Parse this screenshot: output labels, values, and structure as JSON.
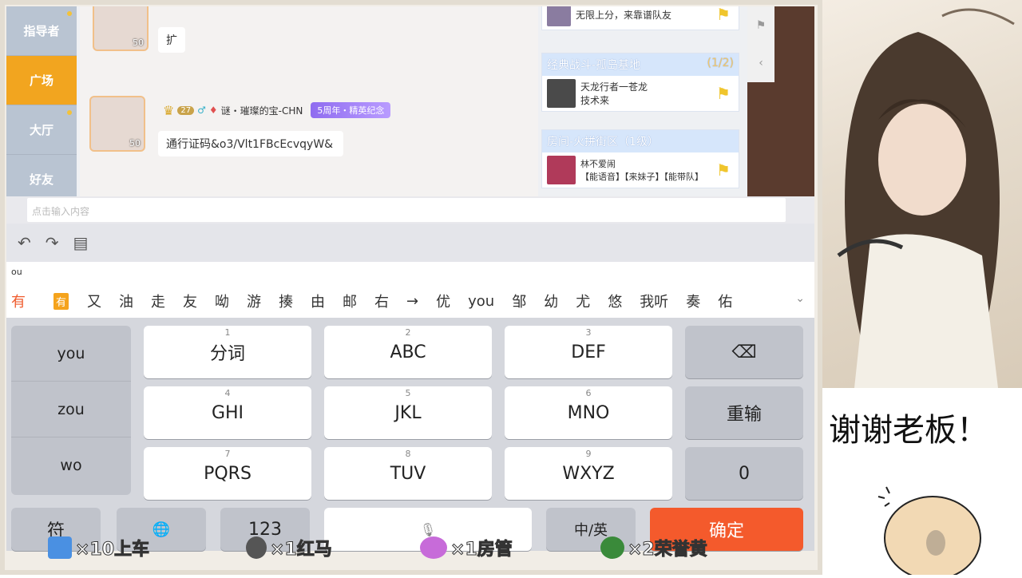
{
  "nav": {
    "tabs": [
      {
        "label": "指导者",
        "dot": true
      },
      {
        "label": "广场",
        "active": true
      },
      {
        "label": "大厅",
        "dot": true
      },
      {
        "label": "好友"
      }
    ]
  },
  "chat": {
    "msg1": {
      "text": "扩",
      "level": "50"
    },
    "msg2": {
      "level": "50",
      "user_level": "27",
      "name": "谜・璀璨的宝-CHN",
      "medal": "5周年・精英纪念",
      "text": "通行证码&o3/Vlt1FBcEcvqyW&"
    }
  },
  "rooms": [
    {
      "title": "",
      "count": "",
      "player": "无限上分，来靠谱队友",
      "sub": ""
    },
    {
      "title": "经典战斗-孤岛基地",
      "count": "(1/2)",
      "player": "天龙行者一苍龙",
      "sub": "技术来"
    },
    {
      "title": "房间-火拼街区（1级）",
      "count": "",
      "player": "林不爱闹",
      "sub": "【能语音】【来妹子】【能带队】"
    }
  ],
  "input": {
    "placeholder": "点击输入内容"
  },
  "candidates": {
    "pinyin": "ou",
    "first": "有",
    "tag": "有",
    "items": [
      "又",
      "油",
      "走",
      "友",
      "呦",
      "游",
      "揍",
      "由",
      "邮",
      "右",
      "→",
      "优",
      "you",
      "邹",
      "幼",
      "尤",
      "悠",
      "我听",
      "奏",
      "佑"
    ]
  },
  "keyboard": {
    "left": [
      "you",
      "zou",
      "wo"
    ],
    "keys": [
      {
        "num": "1",
        "label": "分词"
      },
      {
        "num": "2",
        "label": "ABC"
      },
      {
        "num": "3",
        "label": "DEF"
      },
      {
        "num": "4",
        "label": "GHI"
      },
      {
        "num": "5",
        "label": "JKL"
      },
      {
        "num": "6",
        "label": "MNO"
      },
      {
        "num": "7",
        "label": "PQRS"
      },
      {
        "num": "8",
        "label": "TUV"
      },
      {
        "num": "9",
        "label": "WXYZ"
      }
    ],
    "backspace": "⌫",
    "reenter": "重输",
    "zero": "0",
    "symbol": "符",
    "globe": "🌐",
    "num123": "123",
    "lang": "中/英",
    "confirm": "确定"
  },
  "gifts": [
    {
      "text": "×10上车",
      "color": "#4a90e2"
    },
    {
      "text": "×1红马",
      "color": "#555555"
    },
    {
      "text": "×1房管",
      "color": "#c76bd9"
    },
    {
      "text": "×2荣誉黄",
      "color": "#3a8a3a"
    }
  ],
  "right_panel": {
    "thanks": "谢谢老板！"
  }
}
